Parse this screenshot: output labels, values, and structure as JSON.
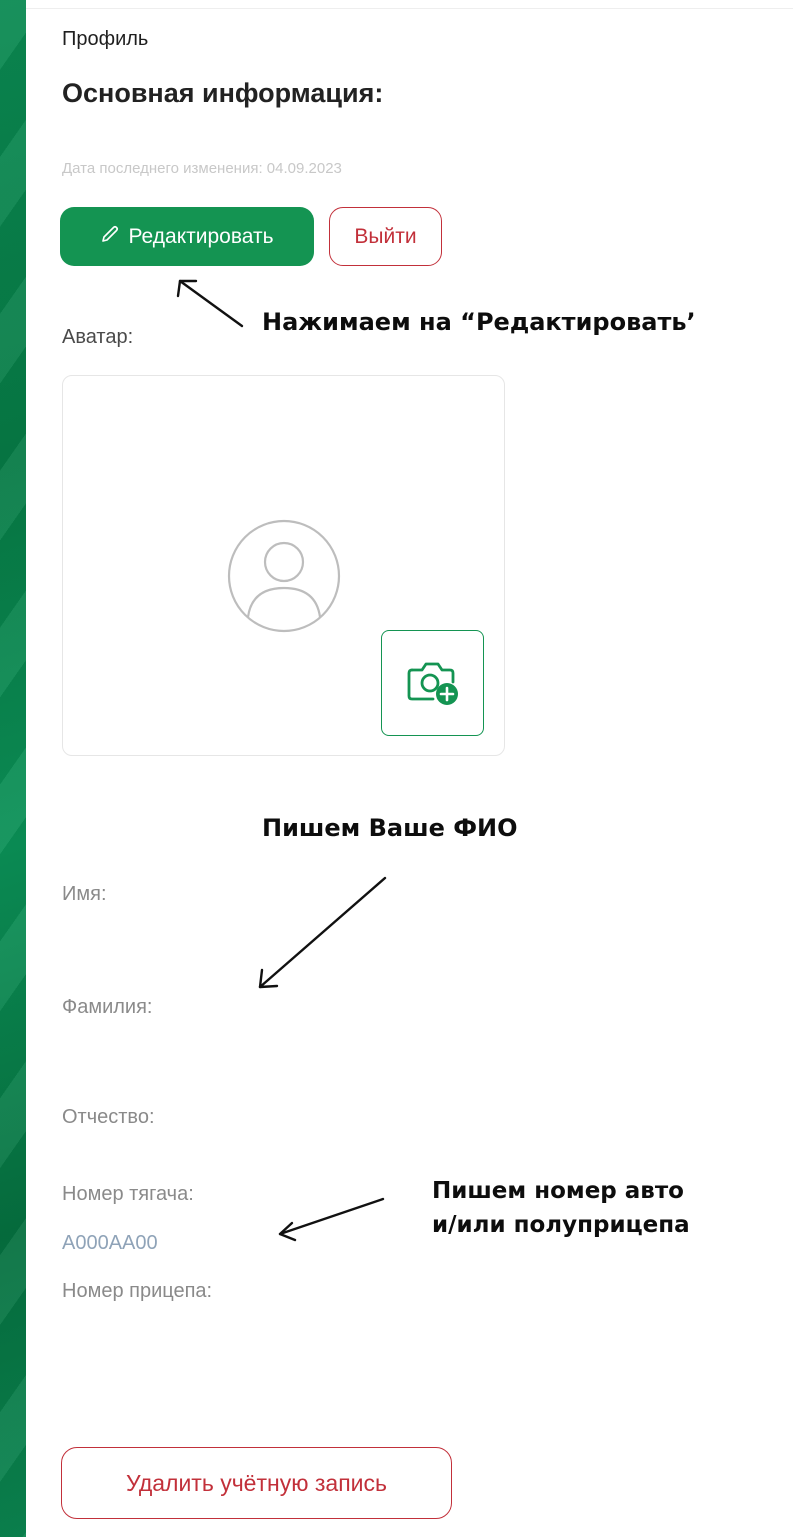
{
  "breadcrumb": "Профиль",
  "title": "Основная информация:",
  "last_changed": "Дата последнего изменения: 04.09.2023",
  "buttons": {
    "edit": "Редактировать",
    "exit": "Выйти",
    "delete_account": "Удалить учётную запись"
  },
  "fields": {
    "avatar": "Аватар:",
    "name": "Имя:",
    "surname": "Фамилия:",
    "patronymic": "Отчество:",
    "tractor_number": "Номер тягача:",
    "tractor_number_value": "A000AA00",
    "trailer_number": "Номер прицепа:"
  },
  "annotations": {
    "click_edit": "Нажимаем на “Редактировать’",
    "write_name": "Пишем Ваше ФИО",
    "write_number_line1": "Пишем номер авто",
    "write_number_line2": "и/или полуприцепа"
  },
  "icons": {
    "edit": "pencil-icon",
    "avatar": "user-placeholder-icon",
    "camera": "camera-plus-icon"
  },
  "colors": {
    "brand_green": "#149452",
    "danger_red": "#c2303a",
    "muted_text": "#8a8a8a",
    "faint_text": "#c8c8c8",
    "value_text": "#8fa3b8"
  }
}
